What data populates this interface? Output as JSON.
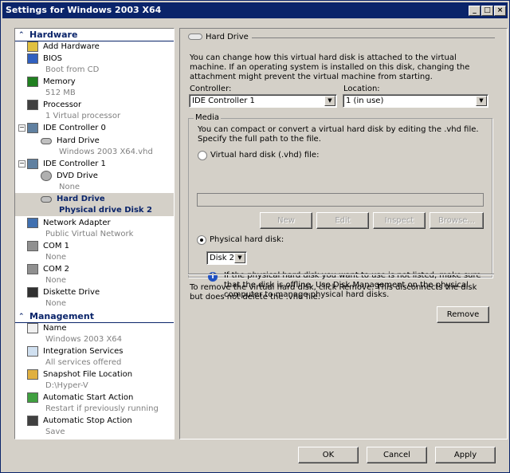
{
  "window": {
    "title": "Settings for Windows 2003 X64",
    "minimize": "_",
    "maximize": "□",
    "close": "×"
  },
  "tree": {
    "hardware_label": "Hardware",
    "management_label": "Management",
    "hardware_items": [
      {
        "label": "Add Hardware",
        "sub": "",
        "icon": "add-hardware-icon"
      },
      {
        "label": "BIOS",
        "sub": "Boot from CD",
        "icon": "bios-icon"
      },
      {
        "label": "Memory",
        "sub": "512 MB",
        "icon": "memory-icon"
      },
      {
        "label": "Processor",
        "sub": "1 Virtual processor",
        "icon": "processor-icon"
      },
      {
        "label": "IDE Controller 0",
        "sub": "",
        "icon": "ide-controller-icon"
      },
      {
        "label": "Hard Drive",
        "sub": "Windows 2003 X64.vhd",
        "icon": "hard-drive-icon"
      },
      {
        "label": "IDE Controller 1",
        "sub": "",
        "icon": "ide-controller-icon"
      },
      {
        "label": "DVD Drive",
        "sub": "None",
        "icon": "dvd-drive-icon"
      },
      {
        "label": "Hard Drive",
        "sub": "Physical  drive Disk 2",
        "icon": "hard-drive-icon",
        "selected": true
      },
      {
        "label": "Network Adapter",
        "sub": "Public Virtual Network",
        "icon": "network-adapter-icon"
      },
      {
        "label": "COM 1",
        "sub": "None",
        "icon": "com-port-icon"
      },
      {
        "label": "COM 2",
        "sub": "None",
        "icon": "com-port-icon"
      },
      {
        "label": "Diskette Drive",
        "sub": "None",
        "icon": "diskette-icon"
      }
    ],
    "management_items": [
      {
        "label": "Name",
        "sub": "Windows 2003 X64",
        "icon": "name-icon"
      },
      {
        "label": "Integration Services",
        "sub": "All services offered",
        "icon": "integration-services-icon"
      },
      {
        "label": "Snapshot File Location",
        "sub": "D:\\Hyper-V",
        "icon": "snapshot-folder-icon"
      },
      {
        "label": "Automatic Start Action",
        "sub": "Restart if previously running",
        "icon": "start-action-icon"
      },
      {
        "label": "Automatic Stop Action",
        "sub": "Save",
        "icon": "stop-action-icon"
      }
    ]
  },
  "panel": {
    "heading": "Hard Drive",
    "intro": "You can change how this virtual hard disk is attached to the virtual machine. If an operating system is installed on this disk, changing the attachment might prevent the virtual machine from starting.",
    "controller_label": "Controller:",
    "controller_value": "IDE Controller 1",
    "location_label": "Location:",
    "location_value": "1 (in use)",
    "media_label": "Media",
    "media_text": "You can compact or convert a virtual hard disk by editing the .vhd file. Specify the full path to the file.",
    "vhd_radio": "Virtual hard disk (.vhd) file:",
    "vhd_path": "",
    "buttons": [
      "New",
      "Edit",
      "Inspect",
      "Browse..."
    ],
    "physical_radio": "Physical hard disk:",
    "physical_value": "Disk 2",
    "info_text": "If the physical hard disk you want to use is not listed, make sure that the disk is offline. Use Disk Management on the physical computer to manage physical hard disks.",
    "remove_text": "To remove the virtual hard disk, click Remove. This disconnects the disk but does not delete the .vhd file.",
    "remove_button": "Remove"
  },
  "footer": {
    "ok": "OK",
    "cancel": "Cancel",
    "apply": "Apply"
  },
  "colors": {
    "titlebar": "#0a246a",
    "face": "#d4d0c8",
    "section": "#0a246a"
  }
}
